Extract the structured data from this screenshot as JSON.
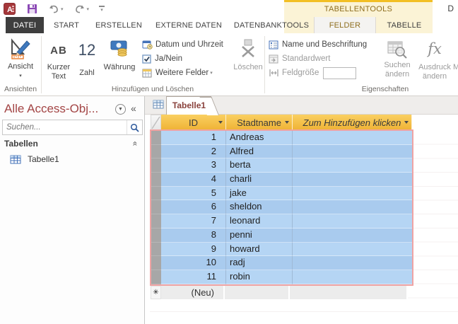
{
  "app": {
    "window_title_fragment": "D"
  },
  "qat": {
    "icons": [
      "access-logo",
      "save",
      "undo",
      "redo",
      "customize-quick-access"
    ]
  },
  "contextual": {
    "label": "TABELLENTOOLS"
  },
  "tabs": {
    "items": [
      {
        "label": "DATEI"
      },
      {
        "label": "START"
      },
      {
        "label": "ERSTELLEN"
      },
      {
        "label": "EXTERNE DATEN"
      },
      {
        "label": "DATENBANKTOOLS"
      },
      {
        "label": "FELDER"
      },
      {
        "label": "TABELLE"
      }
    ],
    "active": "FELDER"
  },
  "ribbon": {
    "ansichten": {
      "view_label": "Ansicht",
      "group_label": "Ansichten"
    },
    "add_delete": {
      "short_text_glyph": "AB",
      "short_text_label": "Kurzer Text",
      "number_glyph": "12",
      "number_label": "Zahl",
      "currency_label": "Währung",
      "datetime_label": "Datum und Uhrzeit",
      "yesno_label": "Ja/Nein",
      "more_fields_label": "Weitere Felder",
      "delete_label": "Löschen",
      "group_label": "Hinzufügen und Löschen"
    },
    "properties": {
      "name_caption_label": "Name und Beschriftung",
      "default_value_label": "Standardwert",
      "field_size_label": "Feldgröße",
      "field_size_value": "",
      "modify_lookups_label": "Suchen ändern",
      "modify_expression_label": "Ausdruck ändern",
      "memo_settings_label_fragment": "Me",
      "group_label": "Eigenschaften"
    }
  },
  "nav": {
    "title": "Alle Access-Obj...",
    "search_placeholder": "Suchen...",
    "group_label": "Tabellen",
    "items": [
      {
        "label": "Tabelle1"
      }
    ]
  },
  "document": {
    "tab_label": "Tabelle1"
  },
  "table": {
    "columns": [
      {
        "label": "ID"
      },
      {
        "label": "Stadtname"
      },
      {
        "label": "Zum Hinzufügen klicken"
      }
    ],
    "rows": [
      {
        "id": 1,
        "stadtname": "Andreas"
      },
      {
        "id": 2,
        "stadtname": "Alfred"
      },
      {
        "id": 3,
        "stadtname": "berta"
      },
      {
        "id": 4,
        "stadtname": "charli"
      },
      {
        "id": 5,
        "stadtname": "jake"
      },
      {
        "id": 6,
        "stadtname": "sheldon"
      },
      {
        "id": 7,
        "stadtname": "leonard"
      },
      {
        "id": 8,
        "stadtname": "penni"
      },
      {
        "id": 9,
        "stadtname": "howard"
      },
      {
        "id": 10,
        "stadtname": "radj"
      },
      {
        "id": 11,
        "stadtname": "robin"
      }
    ],
    "new_row_label": "(Neu)"
  },
  "colors": {
    "header_gold_top": "#FAD061",
    "header_gold_bottom": "#EFB235",
    "selection_blue": "#A9CBEE",
    "selection_blue_alt": "#B5D5F4",
    "selection_border": "#EFA3A3",
    "contextual_accent": "#F2BF24",
    "contextual_text": "#8E6E1E",
    "file_tab_bg": "#3E3E3E",
    "nav_title_red": "#A34545"
  }
}
